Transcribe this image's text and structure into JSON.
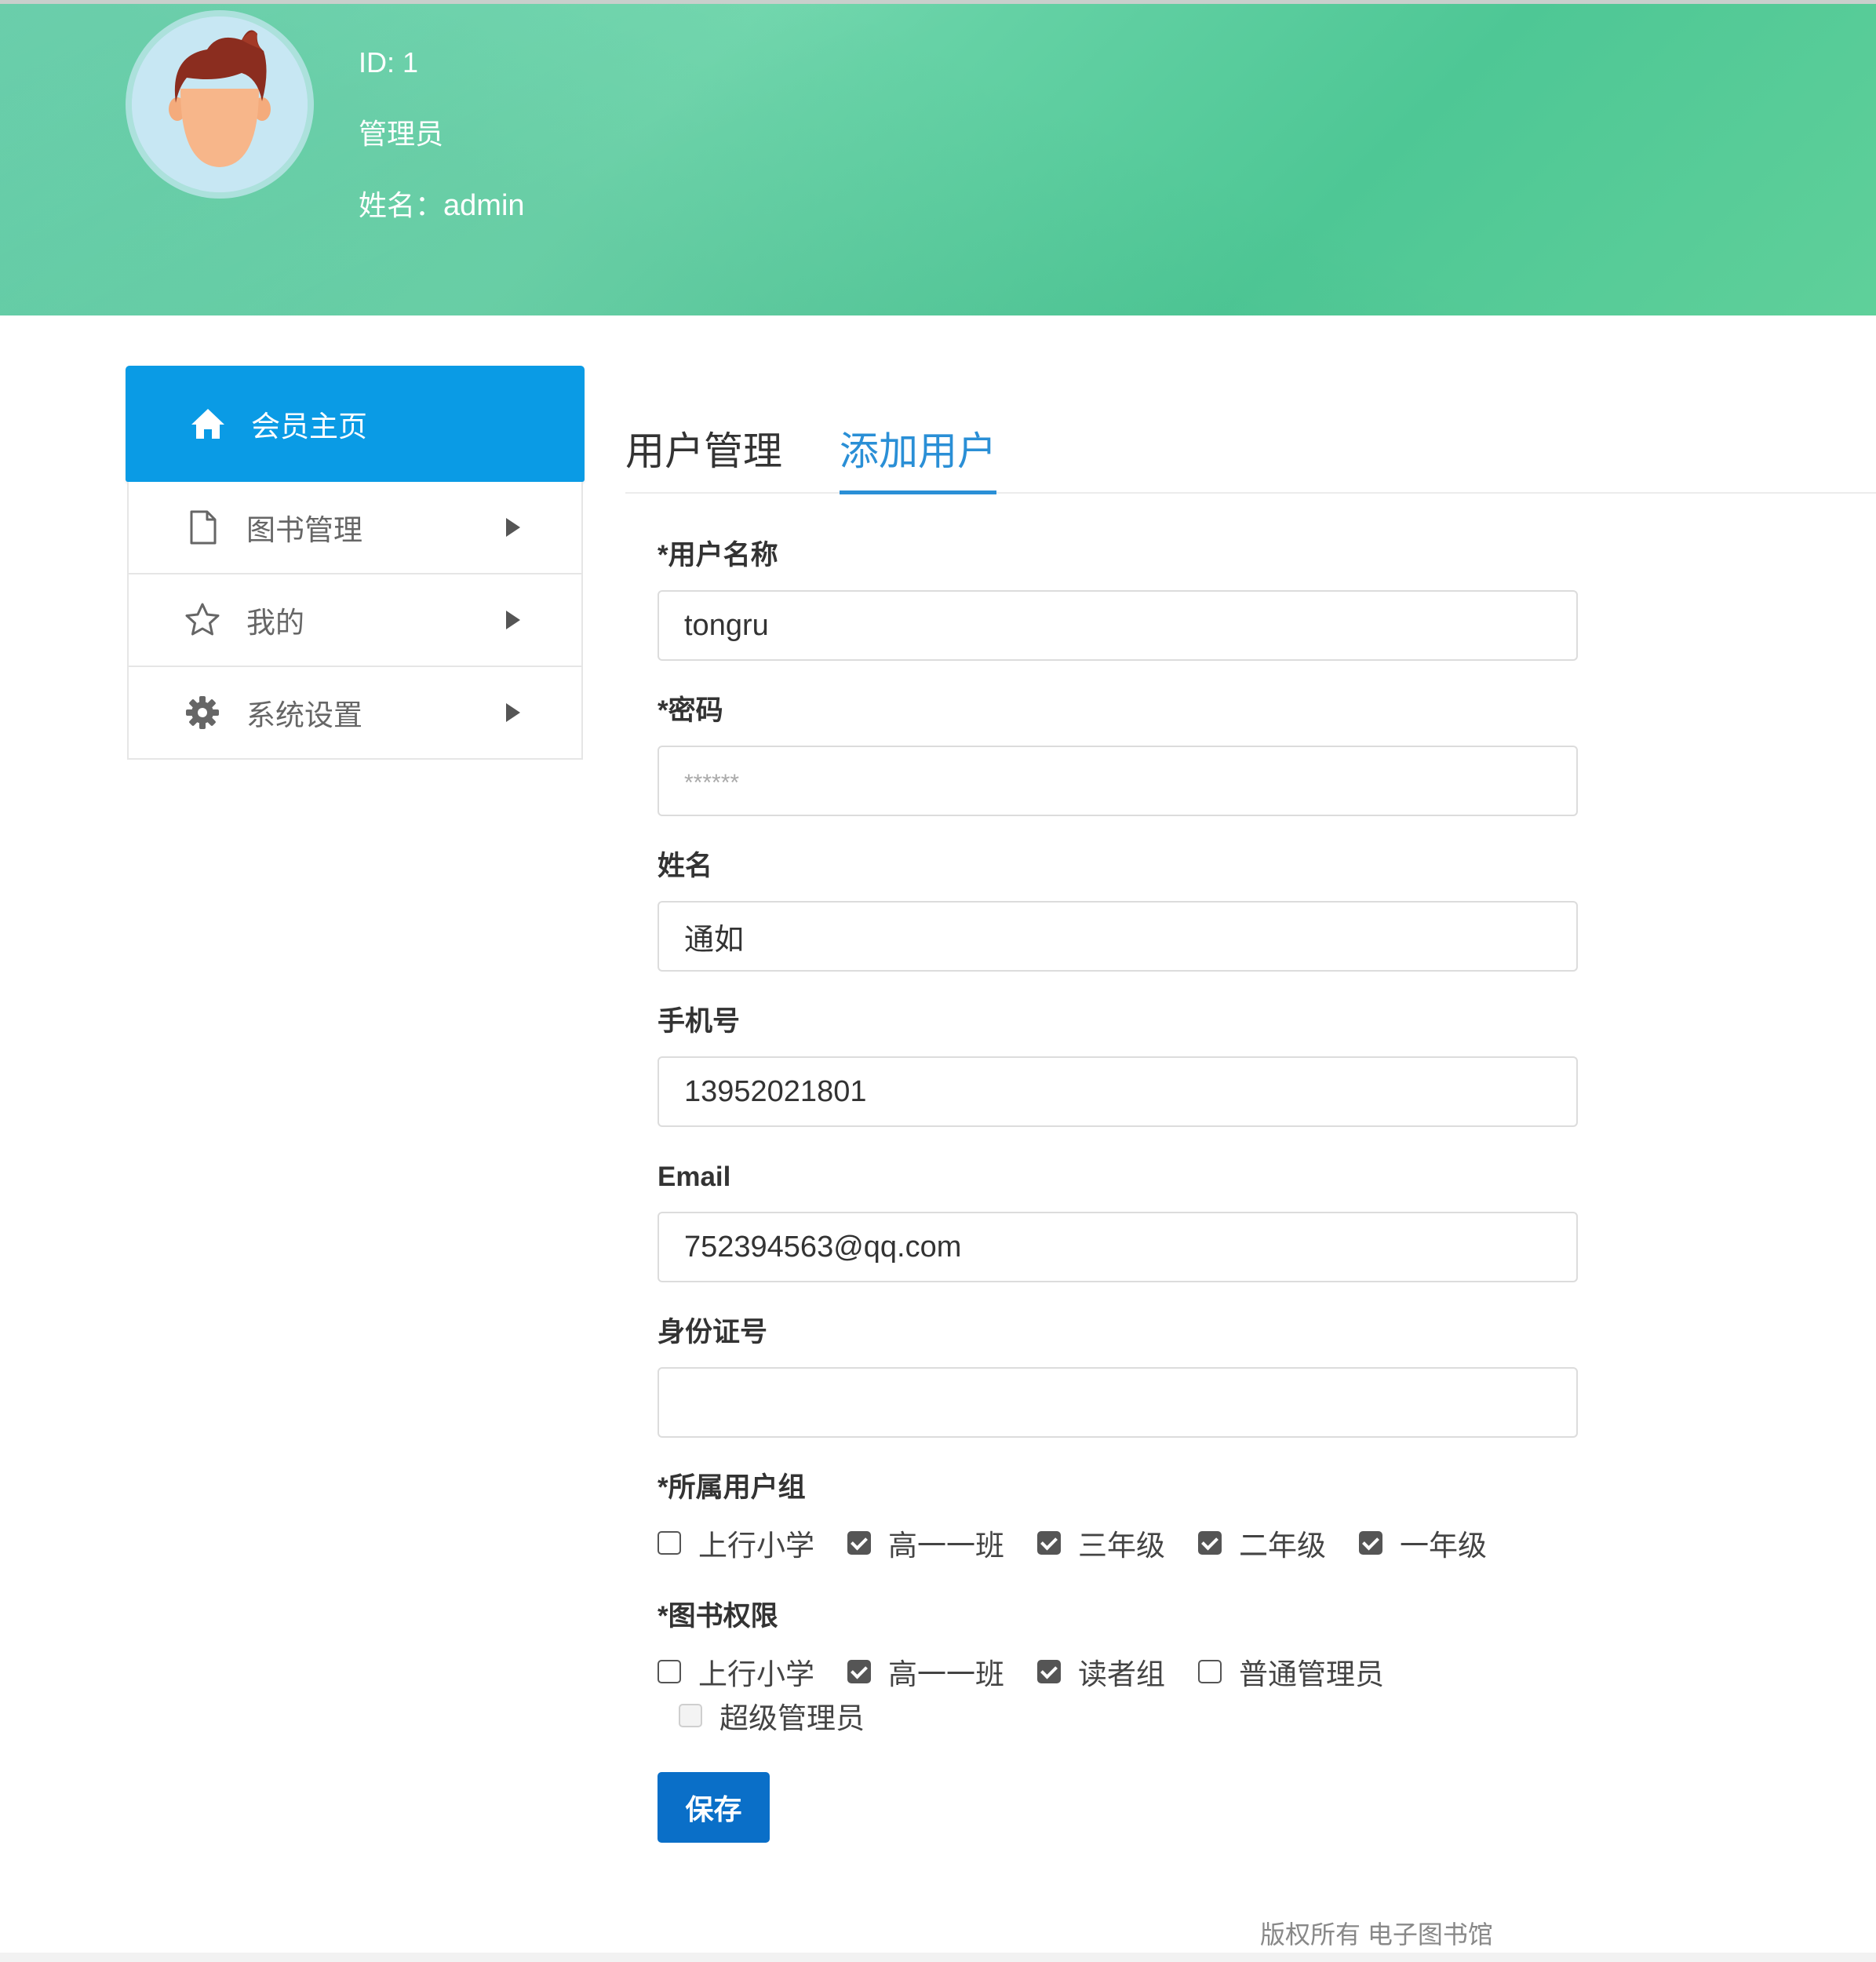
{
  "header": {
    "id_text": "ID: 1",
    "role": "管理员",
    "name_label": "姓名：",
    "name_value": "admin"
  },
  "sidebar": {
    "items": [
      {
        "label": "会员主页",
        "icon": "home-icon",
        "active": true
      },
      {
        "label": "图书管理",
        "icon": "file-icon",
        "active": false
      },
      {
        "label": "我的",
        "icon": "star-icon",
        "active": false
      },
      {
        "label": "系统设置",
        "icon": "gear-icon",
        "active": false
      }
    ]
  },
  "tabs": [
    {
      "label": "用户管理",
      "active": false
    },
    {
      "label": "添加用户",
      "active": true
    }
  ],
  "form": {
    "username": {
      "label": "*用户名称",
      "value": "tongru"
    },
    "password": {
      "label": "*密码",
      "placeholder": "******"
    },
    "realname": {
      "label": "姓名",
      "value": "通如"
    },
    "phone": {
      "label": "手机号",
      "value": "13952021801"
    },
    "email": {
      "label": "Email",
      "value": "752394563@qq.com"
    },
    "idcard": {
      "label": "身份证号",
      "value": ""
    },
    "user_groups": {
      "label": "*所属用户组",
      "options": [
        {
          "label": "上行小学",
          "checked": false
        },
        {
          "label": "高一一班",
          "checked": true
        },
        {
          "label": "三年级",
          "checked": true
        },
        {
          "label": "二年级",
          "checked": true
        },
        {
          "label": "一年级",
          "checked": true
        }
      ]
    },
    "book_permissions": {
      "label": "*图书权限",
      "options": [
        {
          "label": "上行小学",
          "checked": false
        },
        {
          "label": "高一一班",
          "checked": true
        },
        {
          "label": "读者组",
          "checked": true
        },
        {
          "label": "普通管理员",
          "checked": false
        },
        {
          "label": "超级管理员",
          "checked": false,
          "disabled": true
        }
      ]
    },
    "save_label": "保存"
  },
  "footer": {
    "text": "版权所有 电子图书馆"
  },
  "colors": {
    "header_green": "#5fd0a8",
    "sidebar_active": "#0a9be5",
    "tab_active": "#2a8fd6",
    "save_button": "#0a6fc8"
  }
}
